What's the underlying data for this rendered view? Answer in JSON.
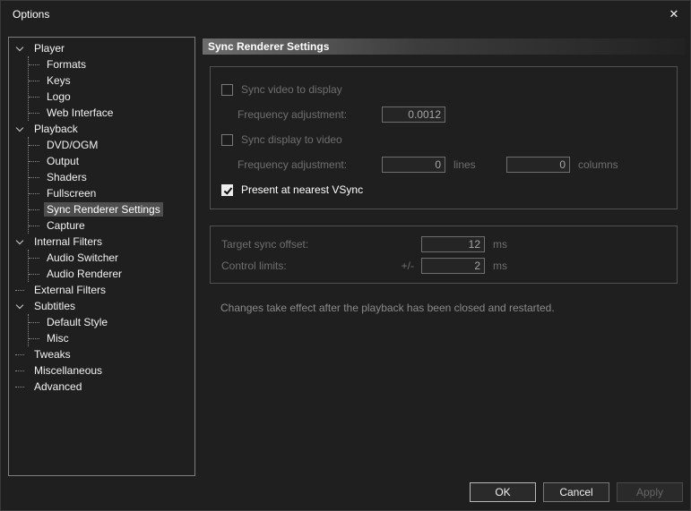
{
  "dialog": {
    "title": "Options",
    "close_glyph": "✕"
  },
  "tree": {
    "items": [
      {
        "label": "Player",
        "level": 0,
        "expanded": true
      },
      {
        "label": "Formats",
        "level": 1
      },
      {
        "label": "Keys",
        "level": 1
      },
      {
        "label": "Logo",
        "level": 1
      },
      {
        "label": "Web Interface",
        "level": 1
      },
      {
        "label": "Playback",
        "level": 0,
        "expanded": true
      },
      {
        "label": "DVD/OGM",
        "level": 1
      },
      {
        "label": "Output",
        "level": 1
      },
      {
        "label": "Shaders",
        "level": 1
      },
      {
        "label": "Fullscreen",
        "level": 1
      },
      {
        "label": "Sync Renderer Settings",
        "level": 1,
        "selected": true
      },
      {
        "label": "Capture",
        "level": 1
      },
      {
        "label": "Internal Filters",
        "level": 0,
        "expanded": true
      },
      {
        "label": "Audio Switcher",
        "level": 1
      },
      {
        "label": "Audio Renderer",
        "level": 1
      },
      {
        "label": "External Filters",
        "level": 0
      },
      {
        "label": "Subtitles",
        "level": 0,
        "expanded": true
      },
      {
        "label": "Default Style",
        "level": 1
      },
      {
        "label": "Misc",
        "level": 1
      },
      {
        "label": "Tweaks",
        "level": 0
      },
      {
        "label": "Miscellaneous",
        "level": 0
      },
      {
        "label": "Advanced",
        "level": 0
      }
    ]
  },
  "panel": {
    "title": "Sync Renderer Settings",
    "group1": {
      "sync_video": {
        "label": "Sync video to display",
        "checked": false
      },
      "freq1": {
        "label": "Frequency adjustment:",
        "value": "0.0012"
      },
      "sync_display": {
        "label": "Sync display to video",
        "checked": false
      },
      "freq2": {
        "label": "Frequency adjustment:",
        "lines_value": "0",
        "lines_unit": "lines",
        "columns_value": "0",
        "columns_unit": "columns"
      },
      "present_vsync": {
        "label": "Present at nearest VSync",
        "checked": true
      }
    },
    "group2": {
      "target_offset": {
        "label": "Target sync offset:",
        "value": "12",
        "unit": "ms"
      },
      "control_limits": {
        "label": "Control limits:",
        "prefix": "+/-",
        "value": "2",
        "unit": "ms"
      }
    },
    "note": "Changes take effect after the playback has been closed and restarted."
  },
  "footer": {
    "ok_label": "OK",
    "cancel_label": "Cancel",
    "apply_label": "Apply"
  }
}
